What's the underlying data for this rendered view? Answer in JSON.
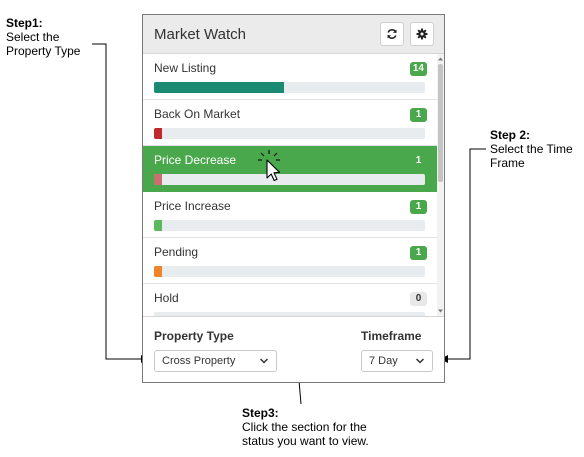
{
  "callouts": {
    "step1": {
      "heading": "Step1:",
      "lines": [
        "Select the",
        "Property Type"
      ]
    },
    "step2": {
      "heading": "Step 2:",
      "lines": [
        "Select the Time",
        "Frame"
      ]
    },
    "step3": {
      "heading": "Step3:",
      "lines": [
        "Click the section for the",
        "status you want to view."
      ]
    }
  },
  "widget": {
    "title": "Market Watch",
    "refresh_icon": "refresh-icon",
    "settings_icon": "gear-icon",
    "rows": [
      {
        "label": "New Listing",
        "count": "14",
        "progress": 0.48,
        "bar_color": "#1a8a73",
        "badge_color": "#49a84b",
        "active": false
      },
      {
        "label": "Back On Market",
        "count": "1",
        "progress": 0.03,
        "bar_color": "#c0282d",
        "badge_color": "#49a84b",
        "active": false
      },
      {
        "label": "Price Decrease",
        "count": "1",
        "progress": 0.03,
        "bar_color": "#c96f6f",
        "badge_color": "#49a84b",
        "active": true
      },
      {
        "label": "Price Increase",
        "count": "1",
        "progress": 0.03,
        "bar_color": "#5cb85c",
        "badge_color": "#49a84b",
        "active": false
      },
      {
        "label": "Pending",
        "count": "1",
        "progress": 0.03,
        "bar_color": "#f0842a",
        "badge_color": "#49a84b",
        "active": false
      },
      {
        "label": "Hold",
        "count": "0",
        "progress": 0.0,
        "bar_color": "#999999",
        "badge_color": "#e8e8e8",
        "active": false
      }
    ],
    "footer": {
      "property_type_label": "Property Type",
      "property_type_value": "Cross Property",
      "timeframe_label": "Timeframe",
      "timeframe_value": "7 Day"
    }
  },
  "colors": {
    "accent": "#49a84b",
    "header_bg": "#ebebeb"
  }
}
